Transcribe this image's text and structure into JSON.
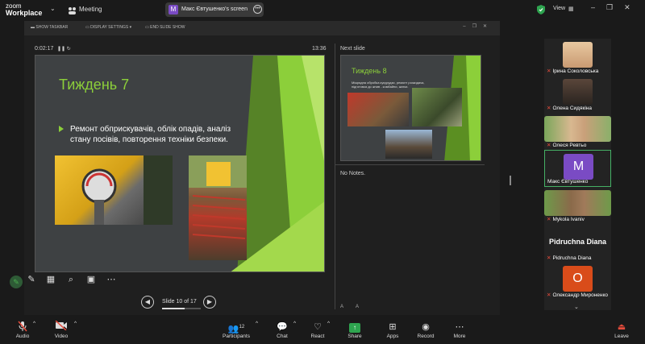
{
  "topbar": {
    "app_line1": "zoom",
    "app_line2": "Workplace",
    "meeting_label": "Meeting",
    "share_badge_initial": "M",
    "share_label": "Макс Євтушенко's screen",
    "view_label": "View"
  },
  "presenter": {
    "toolbar": {
      "show_taskbar": "SHOW TASKBAR",
      "display_settings": "DISPLAY SETTINGS ▾",
      "end_slide_show": "END SLIDE SHOW"
    },
    "timer": "0:02:17",
    "clock": "13:36",
    "slide": {
      "title": "Тиждень 7",
      "bullet": "Ремонт обприскувачів, облік опадів, аналіз стану посівів, повторення техніки безпеки."
    },
    "slide_counter": "Slide 10 of 17",
    "slide_index": 10,
    "slide_total": 17,
    "next_label": "Next slide",
    "next_slide": {
      "title": "Тиждень 8",
      "bullet": "Міжрядна обробка кукурудзи, ремонт розкидача, підготовка до жнив - комбайни, жатки."
    },
    "notes": "No Notes.",
    "font_buttons": "A A"
  },
  "participants": [
    {
      "name": "Ірина Соколовська",
      "muted": true,
      "color": "#d9b38c"
    },
    {
      "name": "Олена Сидякіна",
      "muted": true,
      "color": "#4a3a32"
    },
    {
      "name": "Олеся Ревтьо",
      "muted": true,
      "color": "#b08f6a"
    },
    {
      "name": "Макс Євтушенко",
      "muted": false,
      "initial": "M",
      "color": "#7a4bc4"
    },
    {
      "name": "Mykola Ivaniv",
      "muted": true,
      "color": "#8a6a4a"
    },
    {
      "name": "Pidruchna Diana",
      "muted": true
    },
    {
      "name": "Олександр Мироненко",
      "muted": true,
      "initial": "O",
      "color": "#d94c1a"
    }
  ],
  "bottombar": {
    "audio": "Audio",
    "video": "Video",
    "participants": "Participants",
    "participants_count": "12",
    "chat": "Chat",
    "react": "React",
    "share": "Share",
    "apps": "Apps",
    "record": "Record",
    "more": "More",
    "leave": "Leave"
  },
  "colors": {
    "accent_green": "#8ccf3a",
    "share_green": "#2ea44f",
    "mute_red": "#e74c3c",
    "active_border": "#45b065"
  }
}
